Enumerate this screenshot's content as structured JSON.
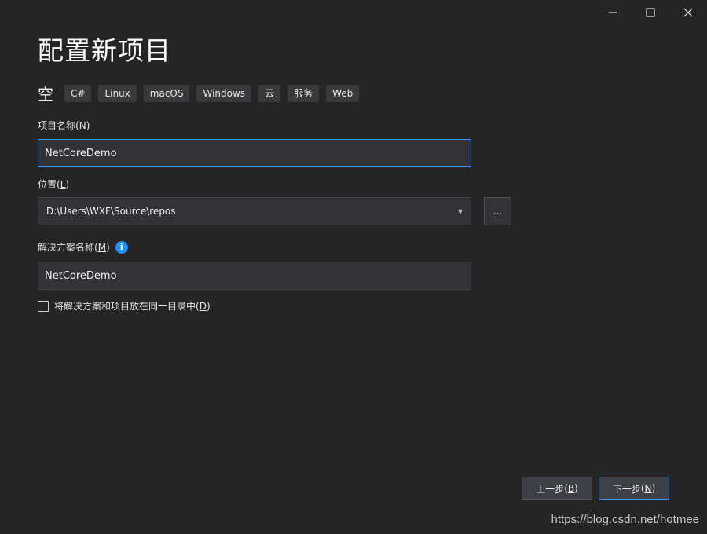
{
  "window": {
    "controls": [
      {
        "name": "minimize-icon",
        "glyph": "minimize"
      },
      {
        "name": "maximize-icon",
        "glyph": "maximize"
      },
      {
        "name": "close-icon",
        "glyph": "close"
      }
    ]
  },
  "title": "配置新项目",
  "template": {
    "name": "空",
    "tags": [
      "C#",
      "Linux",
      "macOS",
      "Windows",
      "云",
      "服务",
      "Web"
    ]
  },
  "project_name": {
    "label": "项目名称",
    "hotkey": "N",
    "value": "NetCoreDemo"
  },
  "location": {
    "label": "位置",
    "hotkey": "L",
    "value": "D:\\Users\\WXF\\Source\\repos",
    "browse_label": "..."
  },
  "solution_name": {
    "label": "解决方案名称",
    "hotkey": "M",
    "value": "NetCoreDemo",
    "info_icon": "i"
  },
  "same_dir": {
    "label": "将解决方案和项目放在同一目录中",
    "hotkey": "D",
    "checked": false
  },
  "buttons": {
    "back": {
      "label": "上一步",
      "hotkey": "B"
    },
    "next": {
      "label": "下一步",
      "hotkey": "N"
    }
  },
  "watermark": "https://blog.csdn.net/hotmee",
  "colors": {
    "background": "#252526",
    "accent": "#3399ff",
    "info": "#1e90ff"
  }
}
